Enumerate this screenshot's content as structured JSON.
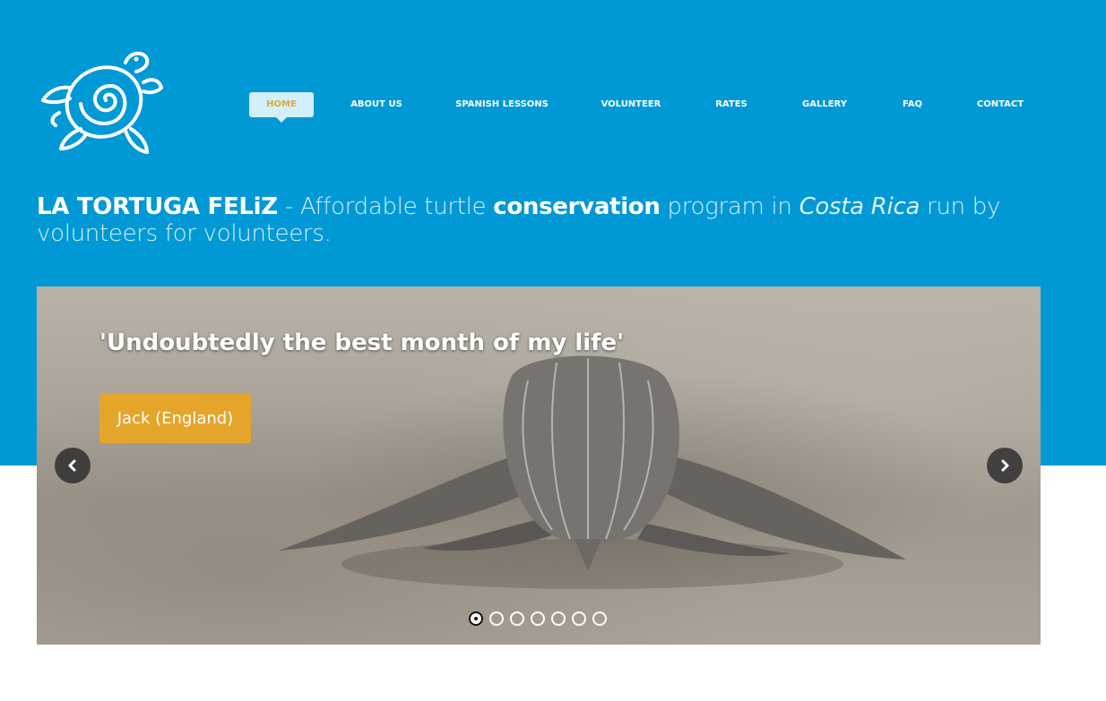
{
  "nav": {
    "items": [
      {
        "label": "HOME",
        "active": true
      },
      {
        "label": "ABOUT US",
        "active": false
      },
      {
        "label": "SPANISH LESSONS",
        "active": false
      },
      {
        "label": "VOLUNTEER",
        "active": false
      },
      {
        "label": "RATES",
        "active": false
      },
      {
        "label": "GALLERY",
        "active": false
      },
      {
        "label": "FAQ",
        "active": false
      },
      {
        "label": "CONTACT",
        "active": false
      }
    ]
  },
  "tagline": {
    "brand": "LA TORTUGA FELiZ",
    "part1": " - Affordable turtle ",
    "strong": "conservation",
    "part2": " program in ",
    "italic": "Costa Rica",
    "part3": " run by volunteers for volunteers."
  },
  "slider": {
    "quote": "'Undoubtedly the best month of my life'",
    "author": "Jack (England)",
    "slide_count": 7,
    "active_slide": 1
  },
  "colors": {
    "brand_blue": "#0099d6",
    "accent_orange": "#e5a52b"
  },
  "icons": {
    "logo": "turtle-spiral-logo",
    "prev": "chevron-left-icon",
    "next": "chevron-right-icon"
  }
}
